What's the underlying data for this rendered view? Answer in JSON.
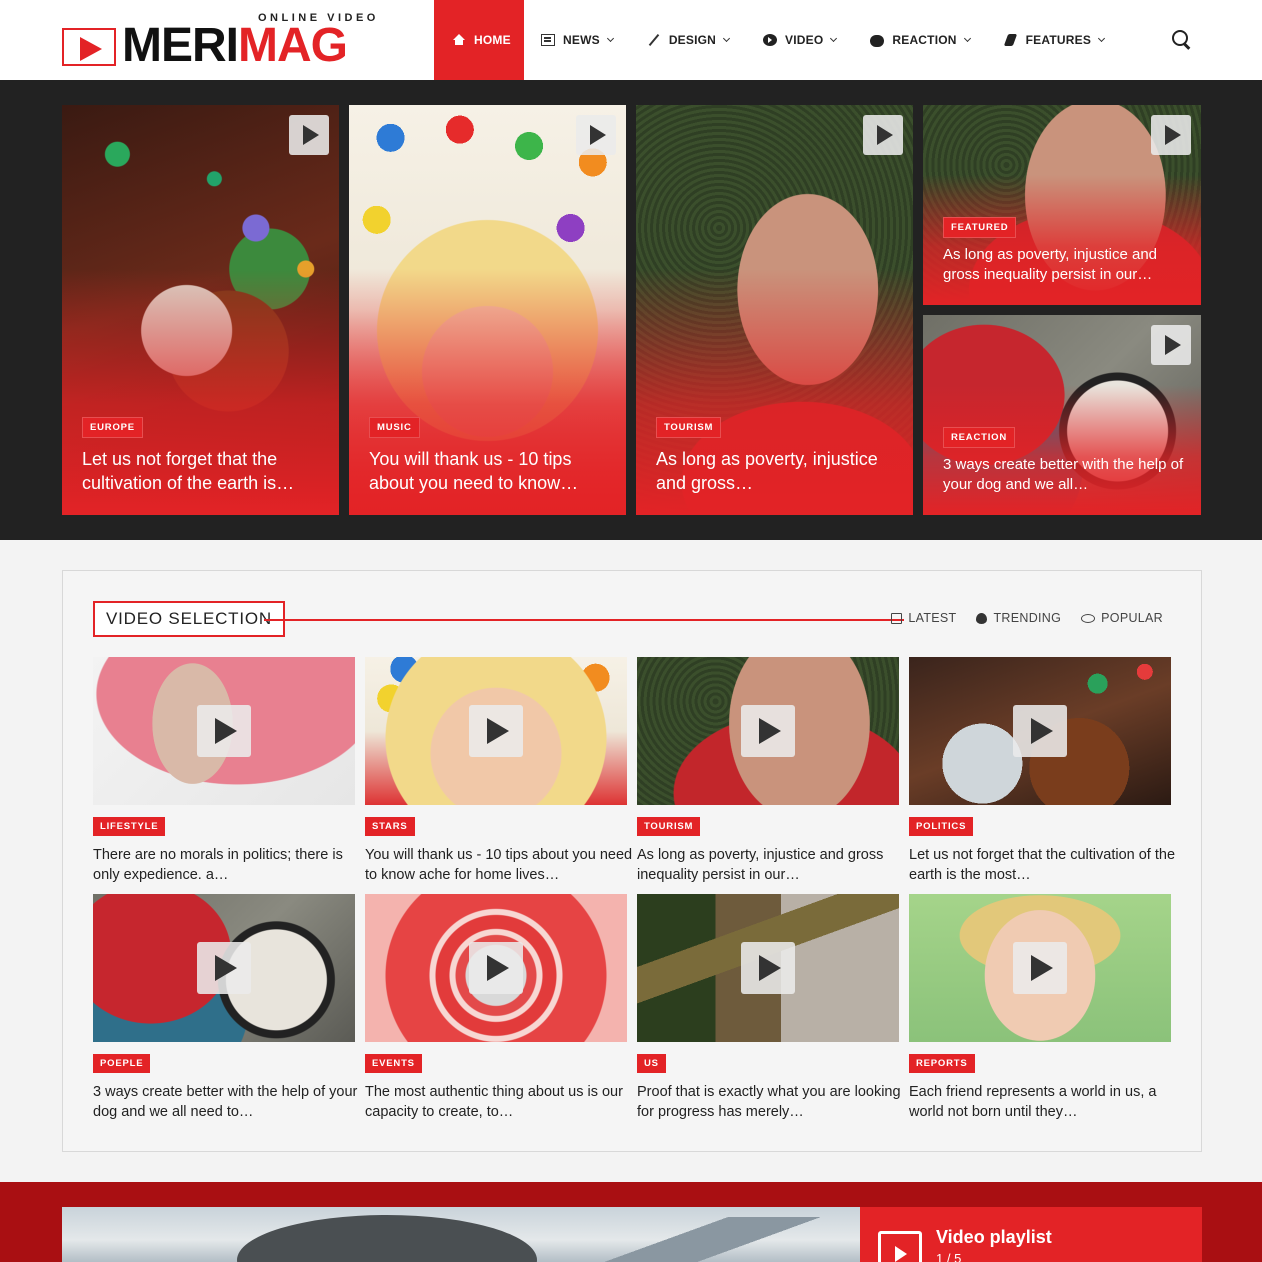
{
  "logo": {
    "tagline": "ONLINE VIDEO",
    "word_a": "MERI",
    "word_b": "MAG"
  },
  "nav": {
    "items": [
      {
        "label": "HOME",
        "icon": "home-icon"
      },
      {
        "label": "NEWS",
        "icon": "news-icon"
      },
      {
        "label": "DESIGN",
        "icon": "pencil-icon"
      },
      {
        "label": "VIDEO",
        "icon": "play-circle-icon"
      },
      {
        "label": "REACTION",
        "icon": "comments-icon"
      },
      {
        "label": "FEATURES",
        "icon": "plug-icon"
      }
    ]
  },
  "hero": {
    "cards": [
      {
        "tag": "EUROPE",
        "title": "Let us not forget that the cultivation of the earth is…"
      },
      {
        "tag": "MUSIC",
        "title": "You will thank us - 10 tips about you need to know…"
      },
      {
        "tag": "TOURISM",
        "title": "As long as poverty, injustice and gross…"
      },
      {
        "tag": "FEATURED",
        "title": "As long as poverty, injustice and gross inequality persist in our…"
      },
      {
        "tag": "REACTION",
        "title": "3 ways create better with the help of your dog and we all…"
      }
    ]
  },
  "video_selection": {
    "title": "VIDEO SELECTION",
    "filters": [
      "LATEST",
      "TRENDING",
      "POPULAR"
    ],
    "items": [
      {
        "tag": "LIFESTYLE",
        "title": "There are no morals in politics; there is only expedience. a…"
      },
      {
        "tag": "STARS",
        "title": "You will thank us - 10 tips about you need to know ache for home lives…"
      },
      {
        "tag": "TOURISM",
        "title": "As long as poverty, injustice and gross inequality persist in our…"
      },
      {
        "tag": "POLITICS",
        "title": "Let us not forget that the cultivation of the earth is the most…"
      },
      {
        "tag": "POEPLE",
        "title": "3 ways create better with the help of your dog and we all need to…"
      },
      {
        "tag": "EVENTS",
        "title": "The most authentic thing about us is our capacity to create, to…"
      },
      {
        "tag": "US",
        "title": "Proof that is exactly what you are looking for progress has merely…"
      },
      {
        "tag": "REPORTS",
        "title": "Each friend represents a world in us, a world not born until they…"
      }
    ]
  },
  "playlist": {
    "title": "Video playlist",
    "count": "1 / 5"
  },
  "colors": {
    "accent": "#e32326",
    "dark": "#222222",
    "playlist_bg": "#a90f12"
  }
}
